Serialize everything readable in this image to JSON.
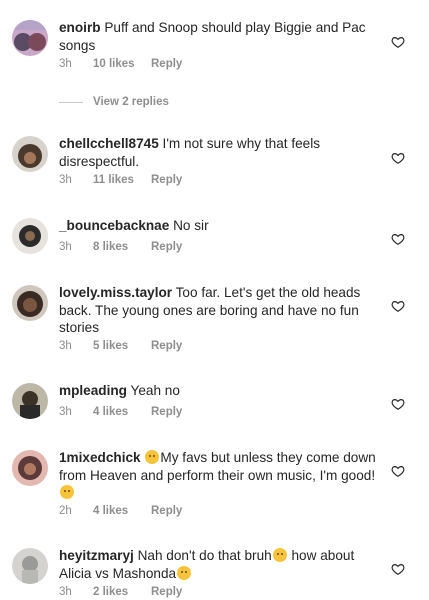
{
  "comments": [
    {
      "username": "enoirb",
      "text": "Puff and Snoop should play Biggie and Pac songs",
      "time": "3h",
      "likes": "10 likes",
      "reply": "Reply",
      "avatar_color": "#5a4a64"
    },
    {
      "username": "chellcchell8745",
      "text": "I'm not sure why that feels disrespectful.",
      "time": "3h",
      "likes": "11 likes",
      "reply": "Reply",
      "avatar_color": "#4a3a2e"
    },
    {
      "username": "_bouncebacknae",
      "text": "No sir",
      "time": "3h",
      "likes": "8 likes",
      "reply": "Reply",
      "avatar_color": "#2b2b2b"
    },
    {
      "username": "lovely.miss.taylor",
      "text": "Too far. Let's get the old heads back. The young ones are boring and have no fun stories",
      "time": "3h",
      "likes": "5 likes",
      "reply": "Reply",
      "avatar_color": "#3a2a24"
    },
    {
      "username": "mpleading",
      "text": "Yeah no",
      "time": "3h",
      "likes": "4 likes",
      "reply": "Reply",
      "avatar_color": "#3b3328"
    },
    {
      "username": "1mixedchick",
      "text_before": "My favs but unless they come down from Heaven and perform their own music, I'm good!",
      "time": "2h",
      "likes": "4 likes",
      "reply": "Reply",
      "avatar_color": "#5c3a3a"
    },
    {
      "username": "heyitzmaryj",
      "text_a": "Nah don't do that bruh",
      "text_b": "how about Alicia vs Mashonda",
      "time": "3h",
      "likes": "2 likes",
      "reply": "Reply",
      "avatar_color": "#9a9a98"
    }
  ],
  "view_replies": "View 2 replies",
  "colors": {
    "text": "#262626",
    "meta": "#8e8e8e",
    "emoji": "#f6c33a"
  }
}
